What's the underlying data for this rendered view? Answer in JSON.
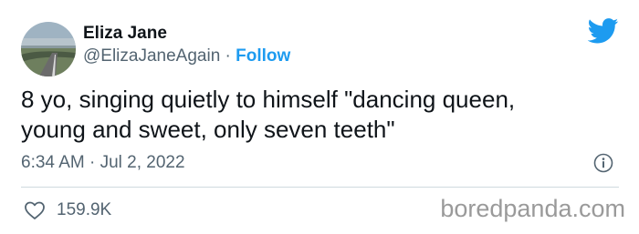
{
  "author": {
    "name": "Eliza Jane",
    "handle": "@ElizaJaneAgain",
    "separator": "·",
    "follow_label": "Follow",
    "avatar_icon": "avatar-photo-road"
  },
  "brand": {
    "icon": "twitter-bird-icon",
    "color": "#1d9bf0"
  },
  "tweet": {
    "line1": "8 yo, singing quietly to himself \"dancing queen,",
    "line2": "young and sweet, only seven teeth\""
  },
  "meta": {
    "timestamp": "6:34 AM · Jul 2, 2022",
    "info_icon": "info-icon"
  },
  "engagement": {
    "like_icon": "heart-icon",
    "likes": "159.9K"
  },
  "watermark": "boredpanda.com"
}
